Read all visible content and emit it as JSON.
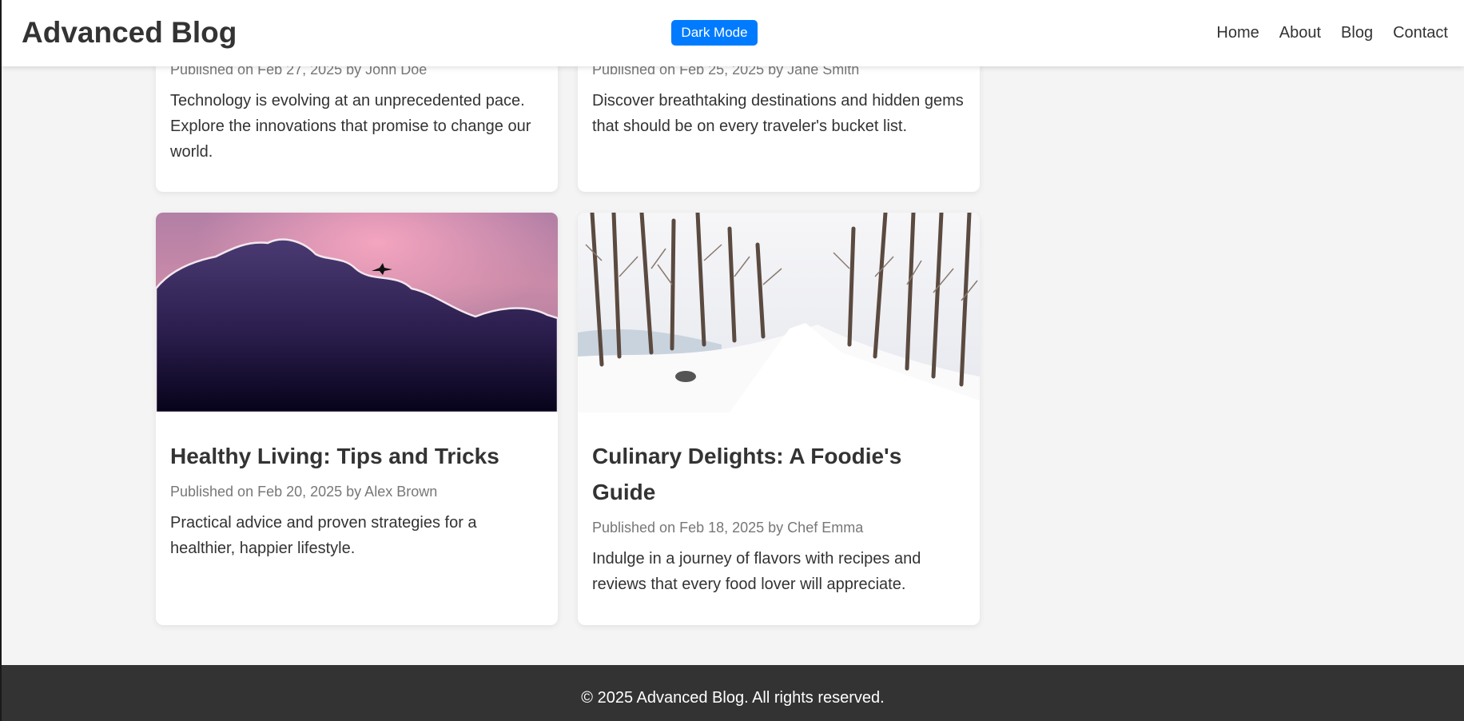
{
  "header": {
    "title": "Advanced Blog",
    "dark_mode_label": "Dark Mode",
    "nav": [
      "Home",
      "About",
      "Blog",
      "Contact"
    ]
  },
  "posts": [
    {
      "title": "",
      "meta": "Published on Feb 27, 2025 by John Doe",
      "excerpt": "Technology is evolving at an unprecedented pace. Explore the innovations that promise to change our world."
    },
    {
      "title": "",
      "meta": "Published on Feb 25, 2025 by Jane Smith",
      "excerpt": "Discover breathtaking destinations and hidden gems that should be on every traveler's bucket list."
    },
    {
      "title": "Healthy Living: Tips and Tricks",
      "meta": "Published on Feb 20, 2025 by Alex Brown",
      "excerpt": "Practical advice and proven strategies for a healthier, happier lifestyle."
    },
    {
      "title": "Culinary Delights: A Foodie's Guide",
      "meta": "Published on Feb 18, 2025 by Chef Emma",
      "excerpt": "Indulge in a journey of flavors with recipes and reviews that every food lover will appreciate."
    }
  ],
  "footer": {
    "text": "© 2025 Advanced Blog. All rights reserved."
  },
  "colors": {
    "accent": "#007bff",
    "footer_bg": "#333333",
    "page_bg": "#f4f4f4"
  }
}
